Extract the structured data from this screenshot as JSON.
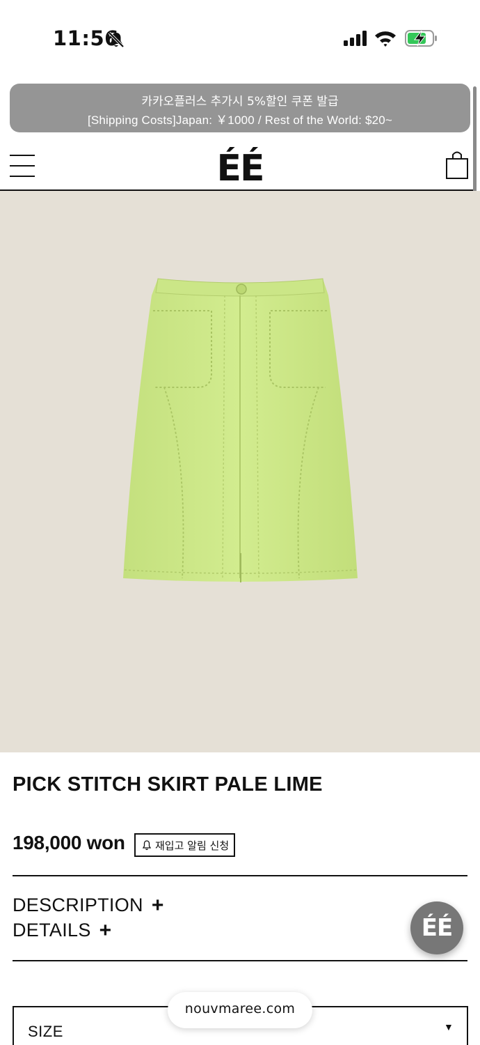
{
  "status_bar": {
    "time": "11:56",
    "bell_icon": "bell-slash-icon",
    "signal_icon": "cellular-signal-icon",
    "wifi_icon": "wifi-icon",
    "battery_icon": "battery-charging-icon",
    "battery_color": "#34c759"
  },
  "announcement": {
    "line1": "카카오플러스 추가시 5%할인 쿠폰 발급",
    "line2": "[Shipping Costs]Japan: ￥1000 / Rest of the World: $20~"
  },
  "header": {
    "logo": "ÉÉ",
    "menu_icon": "hamburger-menu-icon",
    "cart_icon": "shopping-bag-icon"
  },
  "product": {
    "image_subject": "pale lime skirt",
    "image_background": "#e5e0d6",
    "garment_color": "#cfe98a",
    "name": "PICK STITCH SKIRT PALE LIME",
    "price": "198,000 won",
    "restock_label": "재입고 알림 신청"
  },
  "accordions": {
    "description": "DESCRIPTION",
    "details": "DETAILS",
    "plus": "+"
  },
  "fab": {
    "label": "ÉÉ"
  },
  "size_select": {
    "label": "SIZE",
    "arrow": "▼"
  },
  "browser": {
    "url": "nouvmaree.com"
  }
}
